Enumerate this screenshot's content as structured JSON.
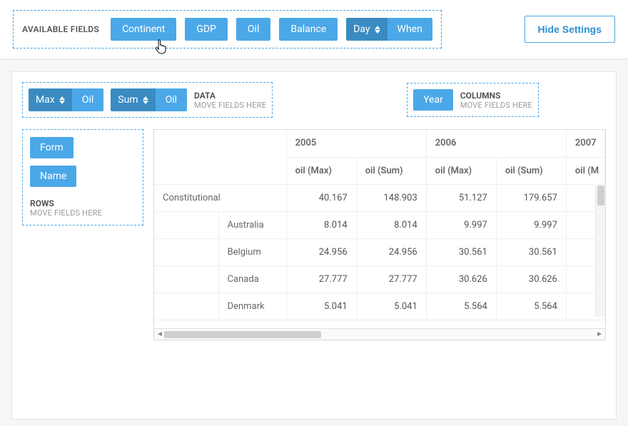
{
  "toolbar": {
    "available_label": "AVAILABLE FIELDS",
    "fields": [
      "Continent",
      "GDP",
      "Oil",
      "Balance",
      "Day",
      "When"
    ],
    "hide_settings": "Hide Settings"
  },
  "zones": {
    "data": {
      "title": "DATA",
      "hint": "MOVE FIELDS HERE",
      "items": [
        {
          "agg": "Max",
          "field": "Oil"
        },
        {
          "agg": "Sum",
          "field": "Oil"
        }
      ]
    },
    "columns": {
      "title": "COLUMNS",
      "hint": "MOVE FIELDS HERE",
      "items": [
        "Year"
      ]
    },
    "rows": {
      "title": "ROWS",
      "hint": "MOVE FIELDS HERE",
      "items": [
        "Form",
        "Name"
      ]
    }
  },
  "pivot": {
    "col_years": [
      "2005",
      "2006",
      "2007"
    ],
    "col_measures": [
      "oil (Max)",
      "oil (Sum)",
      "oil (Max)",
      "oil (Sum)",
      "oil (M"
    ],
    "rows": [
      {
        "l0": "Constitutional",
        "l1": "",
        "v": [
          "40.167",
          "148.903",
          "51.127",
          "179.657",
          ""
        ]
      },
      {
        "l0": "",
        "l1": "Australia",
        "v": [
          "8.014",
          "8.014",
          "9.997",
          "9.997",
          ""
        ]
      },
      {
        "l0": "",
        "l1": "Belgium",
        "v": [
          "24.956",
          "24.956",
          "30.561",
          "30.561",
          ""
        ]
      },
      {
        "l0": "",
        "l1": "Canada",
        "v": [
          "27.777",
          "27.777",
          "30.626",
          "30.626",
          ""
        ]
      },
      {
        "l0": "",
        "l1": "Denmark",
        "v": [
          "5.041",
          "5.041",
          "5.564",
          "5.564",
          ""
        ]
      }
    ]
  }
}
